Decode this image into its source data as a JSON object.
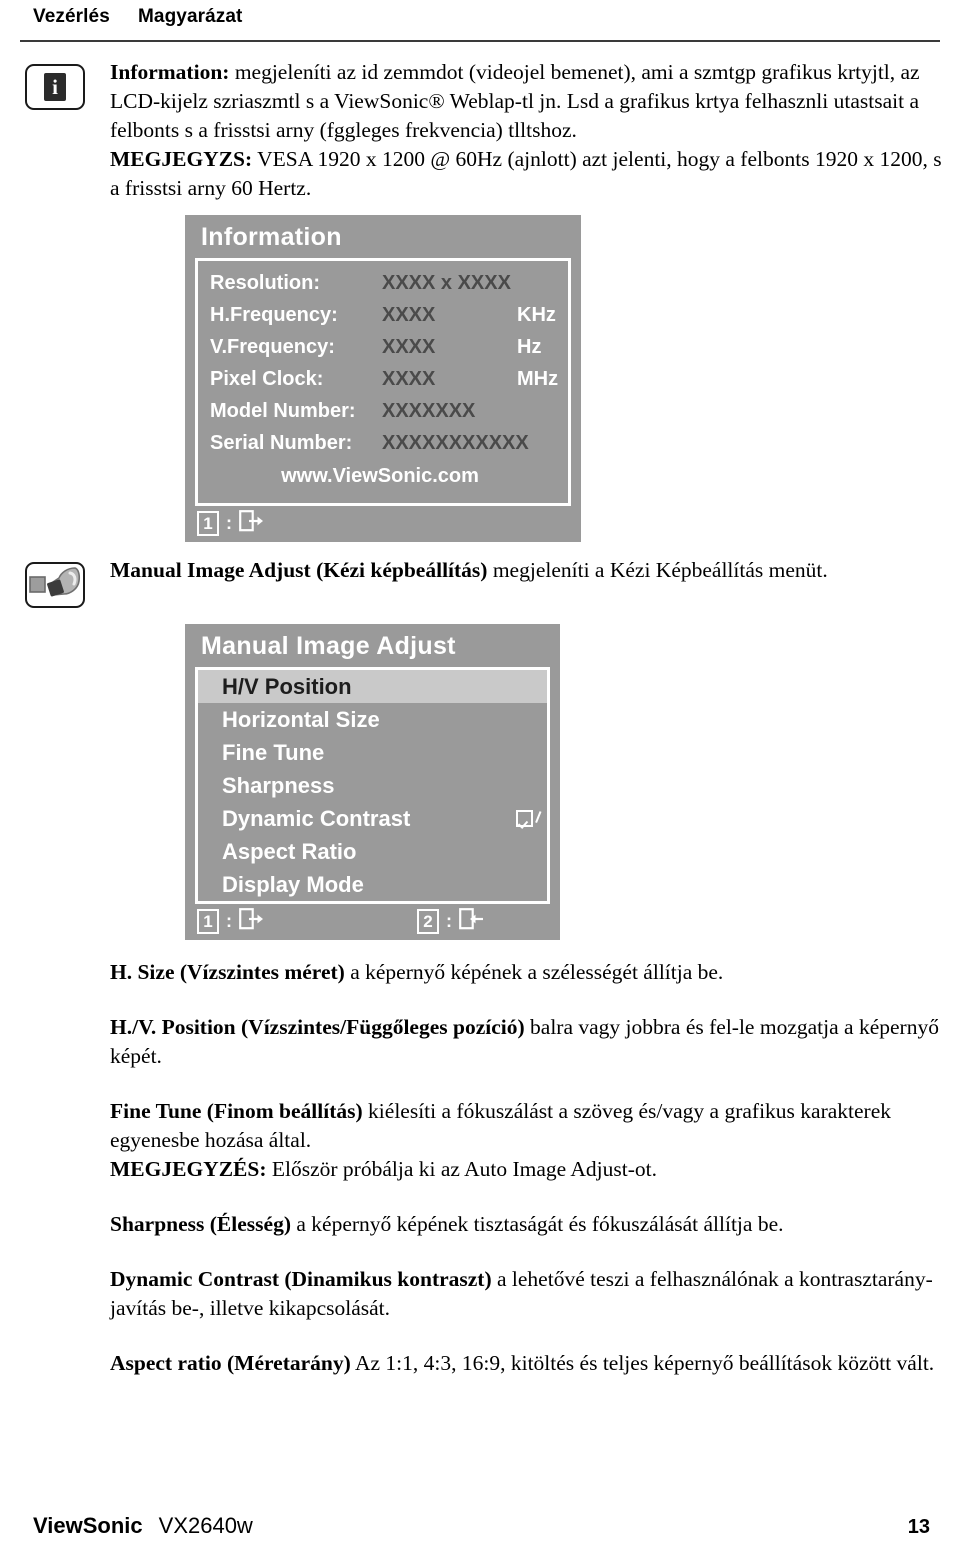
{
  "header": {
    "col_control": "Vezérlés",
    "col_explanation": "Magyarázat"
  },
  "sections": [
    {
      "icon": "information-icon",
      "paragraphs": [
        {
          "bold_lead": "Information:",
          "text": " megjeleníti az id zemmdot (videojel bemenet), ami a szmtgp grafikus krtyjtl, az LCD-kijelz szriaszmtl s a ViewSonic® Weblap-tl jn. Lsd a grafikus krtya felhasznli utastsait a felbonts s a frisstsi arny (fggleges frekvencia) tlltshoz."
        },
        {
          "bold_lead": "MEGJEGYZS:",
          "text": " VESA 1920 x 1200 @ 60Hz (ajnlott) azt jelenti, hogy a felbonts 1920 x 1200, s a frisstsi arny 60 Hertz."
        }
      ]
    },
    {
      "icon": "wrench-icon",
      "paragraphs": [
        {
          "bold_lead": "Manual Image Adjust (Kézi képbeállítás)",
          "text": " megjeleníti a Kézi Képbeállítás menüt."
        }
      ]
    }
  ],
  "osd_information": {
    "title": "Information",
    "rows": [
      {
        "label": "Resolution:",
        "value": "XXXX x XXXX",
        "unit": ""
      },
      {
        "label": "H.Frequency:",
        "value": "XXXX",
        "unit": "KHz"
      },
      {
        "label": "V.Frequency:",
        "value": "XXXX",
        "unit": "Hz"
      },
      {
        "label": "Pixel Clock:",
        "value": "XXXX",
        "unit": "MHz"
      },
      {
        "label": "Model Number:",
        "value": "XXXXXXX",
        "unit": ""
      },
      {
        "label": "Serial Number:",
        "value": "XXXXXXXXXXX",
        "unit": ""
      }
    ],
    "url": "www.ViewSonic.com",
    "hints": [
      {
        "key": "1",
        "separator": ":",
        "icon": "exit-icon"
      }
    ]
  },
  "osd_manual_image_adjust": {
    "title": "Manual Image Adjust",
    "items": [
      {
        "label": "H/V Position",
        "selected": true,
        "checkbox": false
      },
      {
        "label": "Horizontal Size",
        "selected": false,
        "checkbox": false
      },
      {
        "label": "Fine Tune",
        "selected": false,
        "checkbox": false
      },
      {
        "label": "Sharpness",
        "selected": false,
        "checkbox": false
      },
      {
        "label": "Dynamic Contrast",
        "selected": false,
        "checkbox": true
      },
      {
        "label": "Aspect Ratio",
        "selected": false,
        "checkbox": false
      },
      {
        "label": "Display Mode",
        "selected": false,
        "checkbox": false
      }
    ],
    "hints": [
      {
        "key": "1",
        "separator": ":",
        "icon": "exit-icon"
      },
      {
        "key": "2",
        "separator": ":",
        "icon": "back-icon"
      }
    ]
  },
  "descriptions": [
    {
      "bold_lead": "H. Size (Vízszintes méret)",
      "text": " a képernyő képének a szélességét állítja be."
    },
    {
      "bold_lead": "H./V. Position (Vízszintes/Függőleges pozíció)",
      "text": " balra vagy jobbra és fel-le mozgatja a képernyő képét."
    },
    {
      "bold_lead": "Fine Tune (Finom beállítás)",
      "text": " kiélesíti a fókuszálást a szöveg és/vagy a grafikus karakterek egyenesbe hozása által."
    },
    {
      "bold_lead": "MEGJEGYZÉS:",
      "text": " Először próbálja ki az Auto Image Adjust-ot."
    },
    {
      "bold_lead": "Sharpness (Élesség)",
      "text": " a képernyő képének tisztaságát és fókuszálását állítja be."
    },
    {
      "bold_lead": "Dynamic Contrast (Dinamikus kontraszt)",
      "text": " a lehetővé teszi a felhasználónak a kontrasztarány-javítás be-, illetve kikapcsolását."
    },
    {
      "bold_lead": "Aspect ratio (Méretarány)",
      "text": " Az 1:1, 4:3, 16:9, kitöltés és teljes képernyő beállítások között vált."
    }
  ],
  "footer": {
    "brand": "ViewSonic",
    "model": "VX2640w",
    "page_number": "13"
  },
  "colors": {
    "osd_background": "#9a9a9a",
    "osd_selected_row": "#c9c9c9",
    "osd_value_text": "#4a4a4a",
    "rule": "#3a3a3a"
  }
}
